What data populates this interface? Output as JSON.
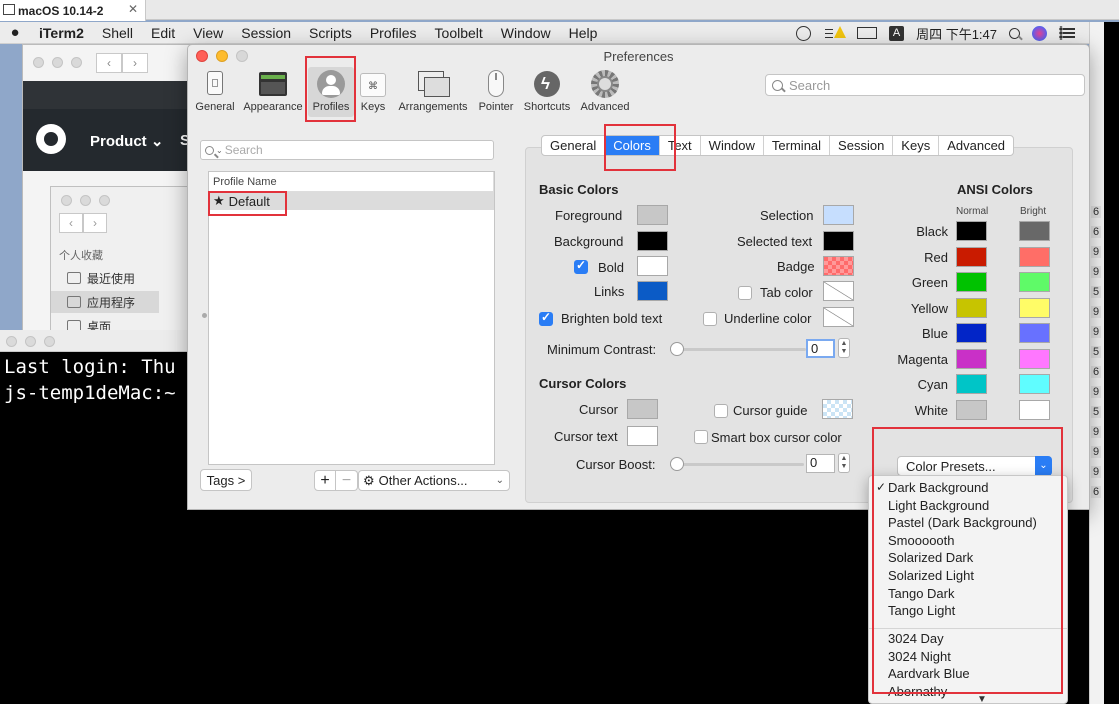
{
  "host": {
    "tab_title": "macOS 10.14-2",
    "close": "✕"
  },
  "menubar": {
    "app": "iTerm2",
    "items": [
      "Shell",
      "Edit",
      "View",
      "Session",
      "Scripts",
      "Profiles",
      "Toolbelt",
      "Window",
      "Help"
    ],
    "clock": "周四 下午1:47",
    "input_icon": "A"
  },
  "browser": {
    "product": "Product ⌄",
    "s": "S"
  },
  "finder": {
    "section": "个人收藏",
    "items": [
      "最近使用",
      "应用程序",
      "桌面"
    ]
  },
  "terminal": {
    "line1": "Last login: Thu",
    "line2": "js-temp1deMac:~"
  },
  "right_strip": {
    "digits": [
      "6",
      "6",
      "9",
      "9",
      "5",
      "9",
      "9",
      "5",
      "6",
      "9",
      "5",
      "9",
      "9",
      "9",
      "6",
      "9"
    ]
  },
  "prefs": {
    "title": "Preferences",
    "search_placeholder": "Search",
    "toolbar": [
      "General",
      "Appearance",
      "Profiles",
      "Keys",
      "Arrangements",
      "Pointer",
      "Shortcuts",
      "Advanced"
    ],
    "profile_search_placeholder": "Search",
    "profile_column": "Profile Name",
    "profiles": [
      {
        "name": "Default",
        "default_marker": "★"
      }
    ],
    "tags_label": "Tags >",
    "add_label": "+",
    "remove_label": "−",
    "other_actions": "Other Actions...",
    "tabs": [
      "General",
      "Colors",
      "Text",
      "Window",
      "Terminal",
      "Session",
      "Keys",
      "Advanced"
    ],
    "active_tab": "Colors"
  },
  "colors": {
    "basic_heading": "Basic Colors",
    "foreground": {
      "label": "Foreground",
      "color": "#c7c7c7"
    },
    "background": {
      "label": "Background",
      "color": "#000000"
    },
    "bold": {
      "label": "Bold",
      "color": "#ffffff",
      "checked": true
    },
    "links": {
      "label": "Links",
      "color": "#0b5bc6"
    },
    "brighten": {
      "label": "Brighten bold text",
      "checked": true
    },
    "selection": {
      "label": "Selection",
      "color": "#c6defe"
    },
    "selected_text": {
      "label": "Selected text",
      "color": "#000000"
    },
    "badge": {
      "label": "Badge",
      "color": "#ff6b6b"
    },
    "tab_color": {
      "label": "Tab color",
      "checked": false
    },
    "underline_color": {
      "label": "Underline color",
      "checked": false
    },
    "min_contrast": {
      "label": "Minimum Contrast:",
      "value": "0",
      "fraction": 0
    },
    "cursor_heading": "Cursor Colors",
    "cursor": {
      "label": "Cursor",
      "color": "#c7c7c7"
    },
    "cursor_text": {
      "label": "Cursor text",
      "color": "#ffffff"
    },
    "cursor_guide": {
      "label": "Cursor guide",
      "checked": false
    },
    "smart_box": {
      "label": "Smart box cursor color",
      "checked": false
    },
    "cursor_boost": {
      "label": "Cursor Boost:",
      "value": "0",
      "fraction": 0
    },
    "ansi_heading": "ANSI Colors",
    "normal_label": "Normal",
    "bright_label": "Bright",
    "ansi": [
      {
        "name": "Black",
        "normal": "#000000",
        "bright": "#686868"
      },
      {
        "name": "Red",
        "normal": "#c91b00",
        "bright": "#ff6e67"
      },
      {
        "name": "Green",
        "normal": "#00c200",
        "bright": "#5ffa68"
      },
      {
        "name": "Yellow",
        "normal": "#c7c400",
        "bright": "#fffc67"
      },
      {
        "name": "Blue",
        "normal": "#0225c7",
        "bright": "#6871ff"
      },
      {
        "name": "Magenta",
        "normal": "#c930c7",
        "bright": "#ff77ff"
      },
      {
        "name": "Cyan",
        "normal": "#00c5c7",
        "bright": "#60fdff"
      },
      {
        "name": "White",
        "normal": "#c7c7c7",
        "bright": "#ffffff"
      }
    ],
    "presets_label": "Color Presets..."
  },
  "preset_menu": {
    "checked_index": 0,
    "group1": [
      "Dark Background",
      "Light Background",
      "Pastel (Dark Background)",
      "Smoooooth",
      "Solarized Dark",
      "Solarized Light",
      "Tango Dark",
      "Tango Light"
    ],
    "group2": [
      "3024 Day",
      "3024 Night",
      "Aardvark Blue",
      "Abernathy"
    ],
    "more_arrow": "▼"
  },
  "accent": "#2a7df5",
  "highlight": "#e2323b"
}
